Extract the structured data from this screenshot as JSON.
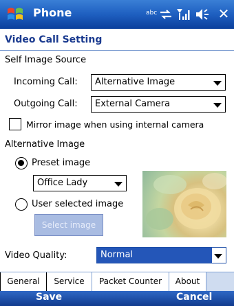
{
  "titlebar": {
    "app_title": "Phone",
    "input_mode": "abc",
    "close_label": "✕"
  },
  "page": {
    "title": "Video Call Setting"
  },
  "self_image": {
    "section_label": "Self Image Source",
    "incoming_label": "Incoming Call:",
    "incoming_value": "Alternative Image",
    "outgoing_label": "Outgoing Call:",
    "outgoing_value": "External Camera",
    "mirror_label": "Mirror image when using internal camera",
    "mirror_checked": false
  },
  "alternative": {
    "section_label": "Alternative Image",
    "preset_label": "Preset image",
    "preset_selected": true,
    "preset_value": "Office Lady",
    "user_label": "User selected image",
    "select_button": "Select image"
  },
  "video_quality": {
    "label": "Video Quality:",
    "value": "Normal"
  },
  "tabs": [
    {
      "label": "General",
      "active": true
    },
    {
      "label": "Service",
      "active": false
    },
    {
      "label": "Packet Counter",
      "active": false
    },
    {
      "label": "About",
      "active": false
    }
  ],
  "softkeys": {
    "left": "Save",
    "right": "Cancel"
  },
  "colors": {
    "title_bar": "#1e5fc0",
    "page_title": "#1a3a8f",
    "selection": "#2456b8"
  }
}
